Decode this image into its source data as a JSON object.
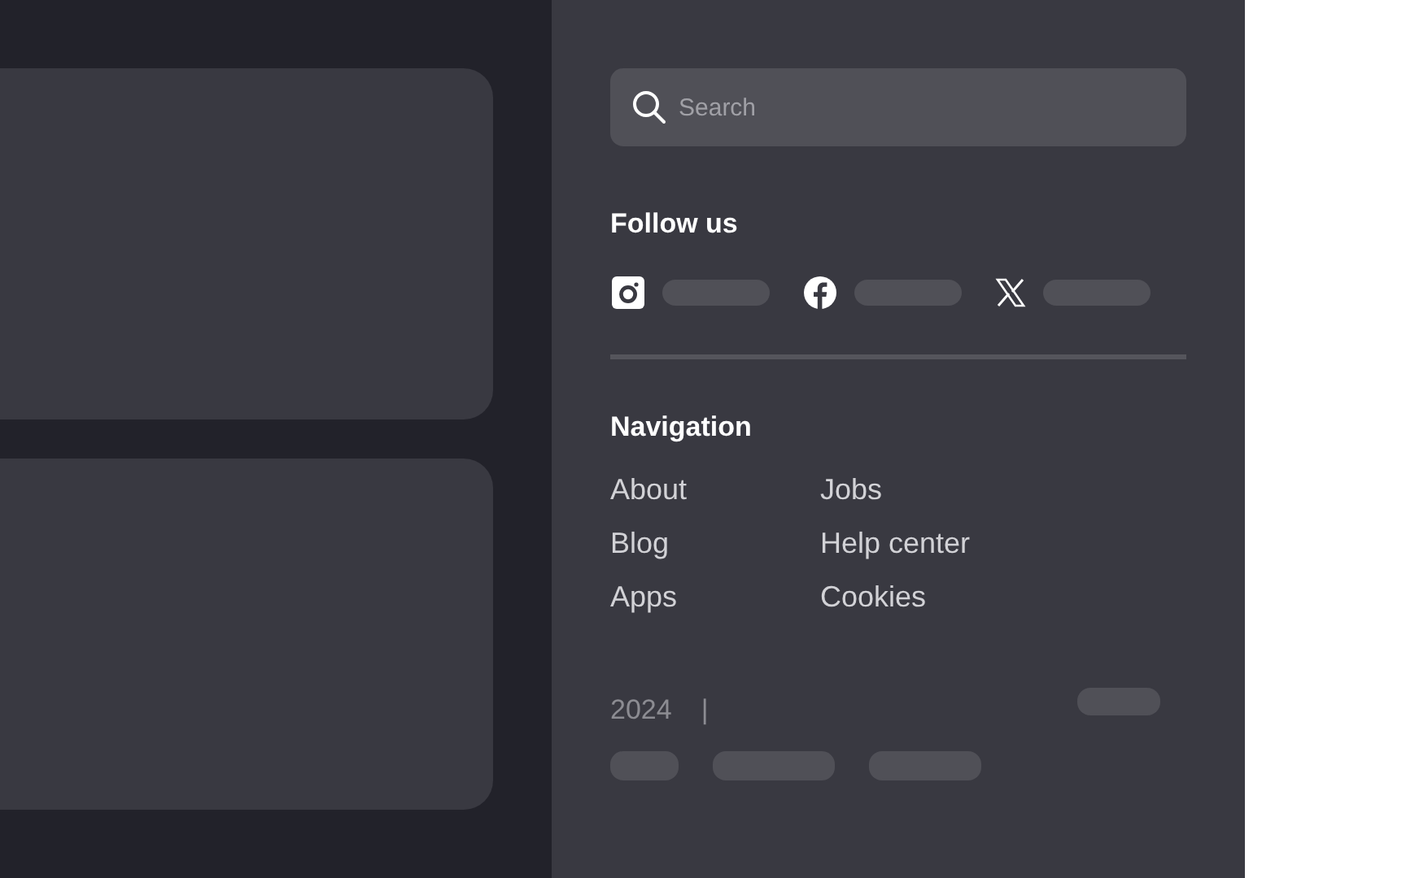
{
  "feed": {
    "cards": [
      {
        "kind": "card"
      },
      {
        "kind": "card"
      }
    ]
  },
  "search": {
    "placeholder": "Search"
  },
  "follow": {
    "title": "Follow us",
    "networks": [
      {
        "kind": "instagram"
      },
      {
        "kind": "facebook"
      },
      {
        "kind": "x"
      }
    ]
  },
  "navigation": {
    "title": "Navigation",
    "columns": [
      [
        "About",
        "Blog",
        "Apps"
      ],
      [
        "Jobs",
        "Help center",
        "Cookies"
      ]
    ]
  },
  "footer": {
    "year": "2024",
    "separator": "|"
  }
}
